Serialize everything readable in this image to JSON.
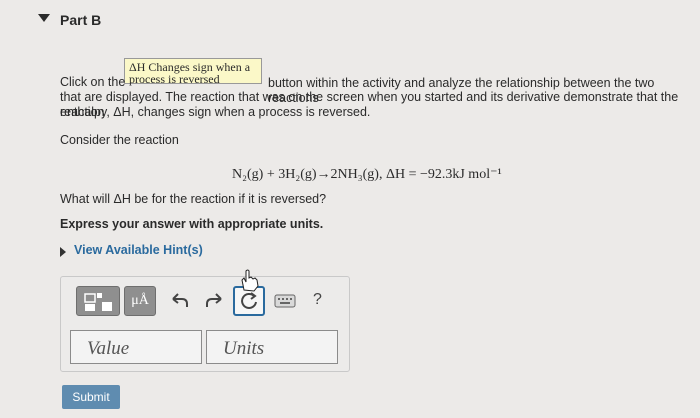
{
  "part": {
    "title": "Part B"
  },
  "activity_button": {
    "label": "ΔH Changes sign when a process is reversed"
  },
  "instructions": {
    "line1_pre": "Click on the",
    "line1_post": "button within the activity and analyze the relationship between the two reactions",
    "line2": "that are displayed. The reaction that was on the screen when you started and its derivative demonstrate that the reaction",
    "line3": "enthalpy, ΔH, changes sign when a process is reversed."
  },
  "consider": "Consider the reaction",
  "reaction": "N₂(g) + 3H₂(g)→2NH₃(g), ΔH = −92.3kJ mol⁻¹",
  "question": "What will ΔH be for the reaction if it is reversed?",
  "units_prompt": "Express your answer with appropriate units.",
  "hints": {
    "label": "View Available Hint(s)"
  },
  "toolbar": {
    "micro_label": "μÅ",
    "help_label": "?"
  },
  "fields": {
    "value_placeholder": "Value",
    "units_placeholder": "Units"
  },
  "submit": {
    "label": "Submit"
  }
}
